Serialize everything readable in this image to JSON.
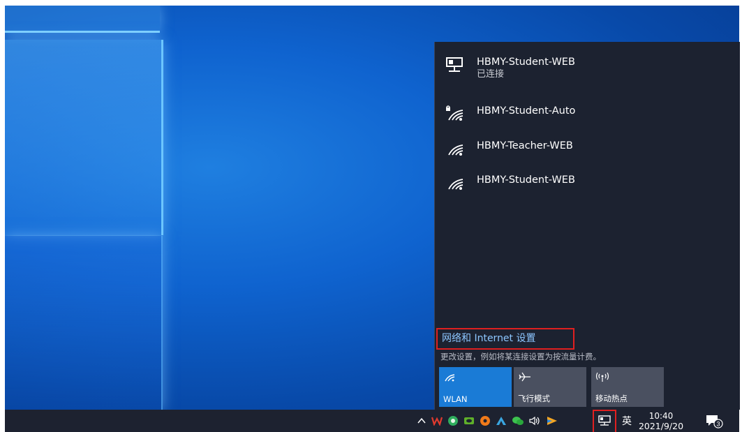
{
  "networks": [
    {
      "name": "HBMY-Student-WEB",
      "status": "已连接",
      "icon": "ethernet-icon"
    },
    {
      "name": "HBMY-Student-Auto",
      "icon": "wifi-secured-icon"
    },
    {
      "name": "HBMY-Teacher-WEB",
      "icon": "wifi-icon"
    },
    {
      "name": "HBMY-Student-WEB",
      "icon": "wifi-icon"
    }
  ],
  "settings": {
    "link": "网络和 Internet 设置",
    "description": "更改设置，例如将某连接设置为按流量计费。"
  },
  "quick_actions": [
    {
      "label": "WLAN",
      "active": true,
      "icon": "wifi-icon"
    },
    {
      "label": "飞行模式",
      "active": false,
      "icon": "airplane-icon"
    },
    {
      "label": "移动热点",
      "active": false,
      "icon": "hotspot-icon"
    }
  ],
  "taskbar": {
    "ime": "英",
    "time": "10:40",
    "date": "2021/9/20",
    "notification_count": "3"
  },
  "colors": {
    "flyout_bg": "#1c2230",
    "accent": "#1a7bd6",
    "link": "#8cc6ff",
    "highlight": "#e02020"
  }
}
